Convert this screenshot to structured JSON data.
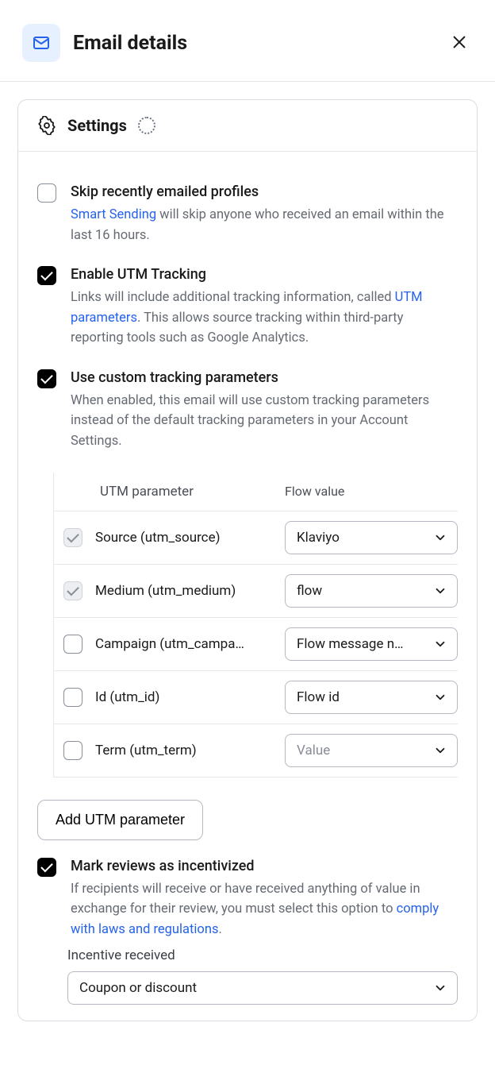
{
  "header": {
    "title": "Email details"
  },
  "panel": {
    "title": "Settings"
  },
  "settings": {
    "skip": {
      "label": "Skip recently emailed profiles",
      "link": "Smart Sending",
      "desc_after": " will skip anyone who received an email within the last 16 hours."
    },
    "utm": {
      "label": "Enable UTM Tracking",
      "desc_before": "Links will include additional tracking information, called ",
      "link": "UTM parameters",
      "desc_after": ". This allows source tracking within third-party reporting tools such as Google Analytics."
    },
    "custom": {
      "label": "Use custom tracking parameters",
      "desc": "When enabled, this email will use custom tracking parameters instead of the default tracking parameters in your Account Settings."
    },
    "incentivized": {
      "label": "Mark reviews as incentivized",
      "desc_before": "If recipients will receive or have received anything of value in exchange for their review, you must select this option to ",
      "link": "comply with laws and regulations",
      "desc_after": "."
    }
  },
  "utm_table": {
    "header_param": "UTM parameter",
    "header_value": "Flow value",
    "rows": [
      {
        "param": "Source (utm_source)",
        "value": "Klaviyo",
        "locked": true,
        "checked": true,
        "placeholder": false
      },
      {
        "param": "Medium (utm_medium)",
        "value": "flow",
        "locked": true,
        "checked": true,
        "placeholder": false
      },
      {
        "param": "Campaign (utm_campa…",
        "value": "Flow message n…",
        "locked": false,
        "checked": false,
        "placeholder": false
      },
      {
        "param": "Id (utm_id)",
        "value": "Flow id",
        "locked": false,
        "checked": false,
        "placeholder": false
      },
      {
        "param": "Term (utm_term)",
        "value": "Value",
        "locked": false,
        "checked": false,
        "placeholder": true
      }
    ],
    "add_button": "Add UTM parameter"
  },
  "incentive": {
    "label": "Incentive received",
    "value": "Coupon or discount"
  }
}
